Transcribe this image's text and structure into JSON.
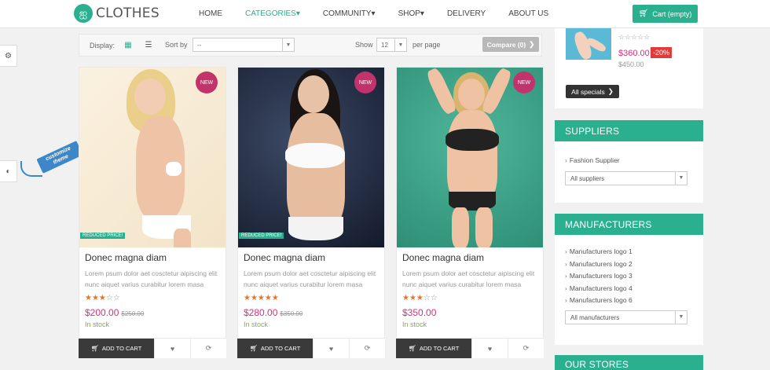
{
  "header": {
    "logo_text": "CLOTHES",
    "nav": [
      "HOME",
      "CATEGORIES",
      "COMMUNITY",
      "SHOP",
      "DELIVERY",
      "ABOUT US"
    ],
    "cart_label": "Cart (empty)"
  },
  "side": {
    "customize_line1": "customize",
    "customize_line2": "theme"
  },
  "toolbar": {
    "display_label": "Display:",
    "sort_label": "Sort by",
    "sort_value": "--",
    "show_label": "Show",
    "show_value": "12",
    "per_page_label": "per page",
    "compare_label": "Compare (0)"
  },
  "products": [
    {
      "badge": "NEW",
      "flag": "REDUCED PRICE!",
      "title": "Donec magna diam",
      "desc": "Lorem psum dolor aet cosctetur aipiscing elit nunc aiquet varius curabitur lorem masa",
      "rating": 3,
      "stars": "★★★☆☆",
      "price": "$200.00",
      "old_price": "$250.00",
      "stock": "In stock",
      "add_label": "ADD TO CART"
    },
    {
      "badge": "NEW",
      "flag": "REDUCED PRICE!",
      "title": "Donec magna diam",
      "desc": "Lorem psum dolor aet cosctetur aipiscing elit nunc aiquet varius curabitur lorem masa",
      "rating": 5,
      "stars": "★★★★★",
      "price": "$280.00",
      "old_price": "$350.00",
      "stock": "In stock",
      "add_label": "ADD TO CART"
    },
    {
      "badge": "NEW",
      "flag": "",
      "title": "Donec magna diam",
      "desc": "Lorem psum dolor aet cosctetur aipiscing elit nunc aiquet varius curabitur lorem masa",
      "rating": 3,
      "stars": "★★★☆☆",
      "price": "$350.00",
      "old_price": "",
      "stock": "In stock",
      "add_label": "ADD TO CART"
    }
  ],
  "specials": {
    "stars": "☆☆☆☆☆",
    "price": "$360.00",
    "discount": "-20%",
    "old_price": "$450.00",
    "button": "All specials"
  },
  "suppliers": {
    "title": "SUPPLIERS",
    "items": [
      "Fashion Supplier"
    ],
    "select": "All suppliers"
  },
  "manufacturers": {
    "title": "MANUFACTURERS",
    "items": [
      "Manufacturers logo 1",
      "Manufacturers logo 2",
      "Manufacturers logo 3",
      "Manufacturers logo 4",
      "Manufacturers logo 6"
    ],
    "select": "All manufacturers"
  },
  "stores": {
    "title": "OUR STORES"
  },
  "colors": {
    "accent": "#2bb08f",
    "price": "#d1337b",
    "badge": "#c2336b",
    "dark_button": "#3a3a3a"
  },
  "icons": [
    "butterfly-icon",
    "cart-icon",
    "gear-icon",
    "contrast-icon",
    "grid-icon",
    "list-icon",
    "chevron-right-icon",
    "heart-icon",
    "refresh-icon"
  ]
}
